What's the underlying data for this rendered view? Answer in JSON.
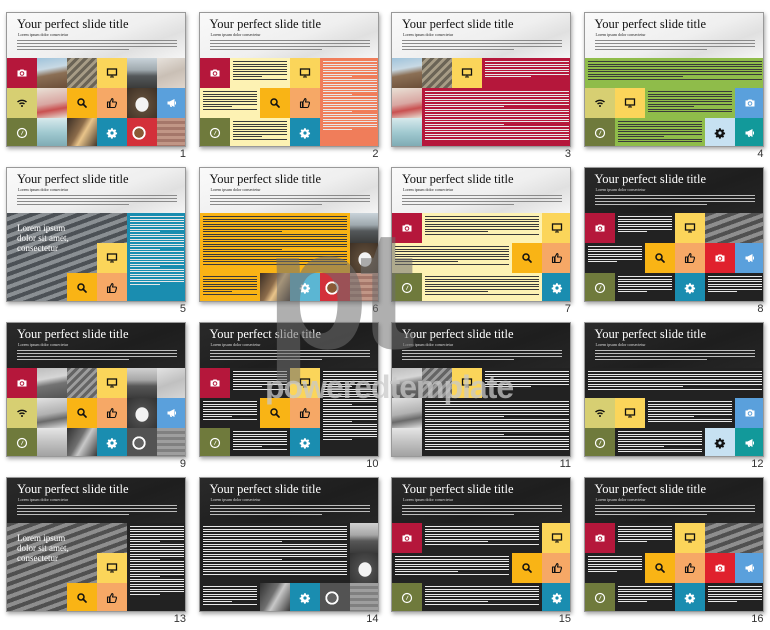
{
  "slide_title": "Your perfect slide title",
  "slide_subtitle": "Lorem ipsum dolor consectetur",
  "overlay_text": "Lorem ipsum dolor sit amet, consectetur",
  "watermark": {
    "letters": "pt",
    "brand": "poweredtemplate"
  },
  "colors": {
    "crimson": "#b5173b",
    "yellow": "#fbd55a",
    "orange_yellow": "#f9b415",
    "peach": "#f6a866",
    "teal_blue": "#1a8db0",
    "olive": "#6f7a3c",
    "khaki": "#d7cf72",
    "sky": "#5aa0dc",
    "coral": "#f07d5a",
    "pale_yellow": "#fdf2b3",
    "green": "#8fbc4a",
    "light_blue": "#c7e1f2",
    "teal": "#12999a",
    "red": "#e0202d",
    "dark": "#222222"
  },
  "slides": [
    {
      "number": "1",
      "theme": "light"
    },
    {
      "number": "2",
      "theme": "light"
    },
    {
      "number": "3",
      "theme": "light"
    },
    {
      "number": "4",
      "theme": "light"
    },
    {
      "number": "5",
      "theme": "light"
    },
    {
      "number": "6",
      "theme": "light"
    },
    {
      "number": "7",
      "theme": "light"
    },
    {
      "number": "8",
      "theme": "dark"
    },
    {
      "number": "9",
      "theme": "dark"
    },
    {
      "number": "10",
      "theme": "dark"
    },
    {
      "number": "11",
      "theme": "dark"
    },
    {
      "number": "12",
      "theme": "dark"
    },
    {
      "number": "13",
      "theme": "dark"
    },
    {
      "number": "14",
      "theme": "dark"
    },
    {
      "number": "15",
      "theme": "dark"
    },
    {
      "number": "16",
      "theme": "dark"
    }
  ],
  "icons": [
    "camera-icon",
    "wifi-icon",
    "compass-icon",
    "monitor-icon",
    "search-icon",
    "thumbs-up-icon",
    "gear-icon",
    "megaphone-icon",
    "coffee-photo",
    "laptop-photo"
  ]
}
